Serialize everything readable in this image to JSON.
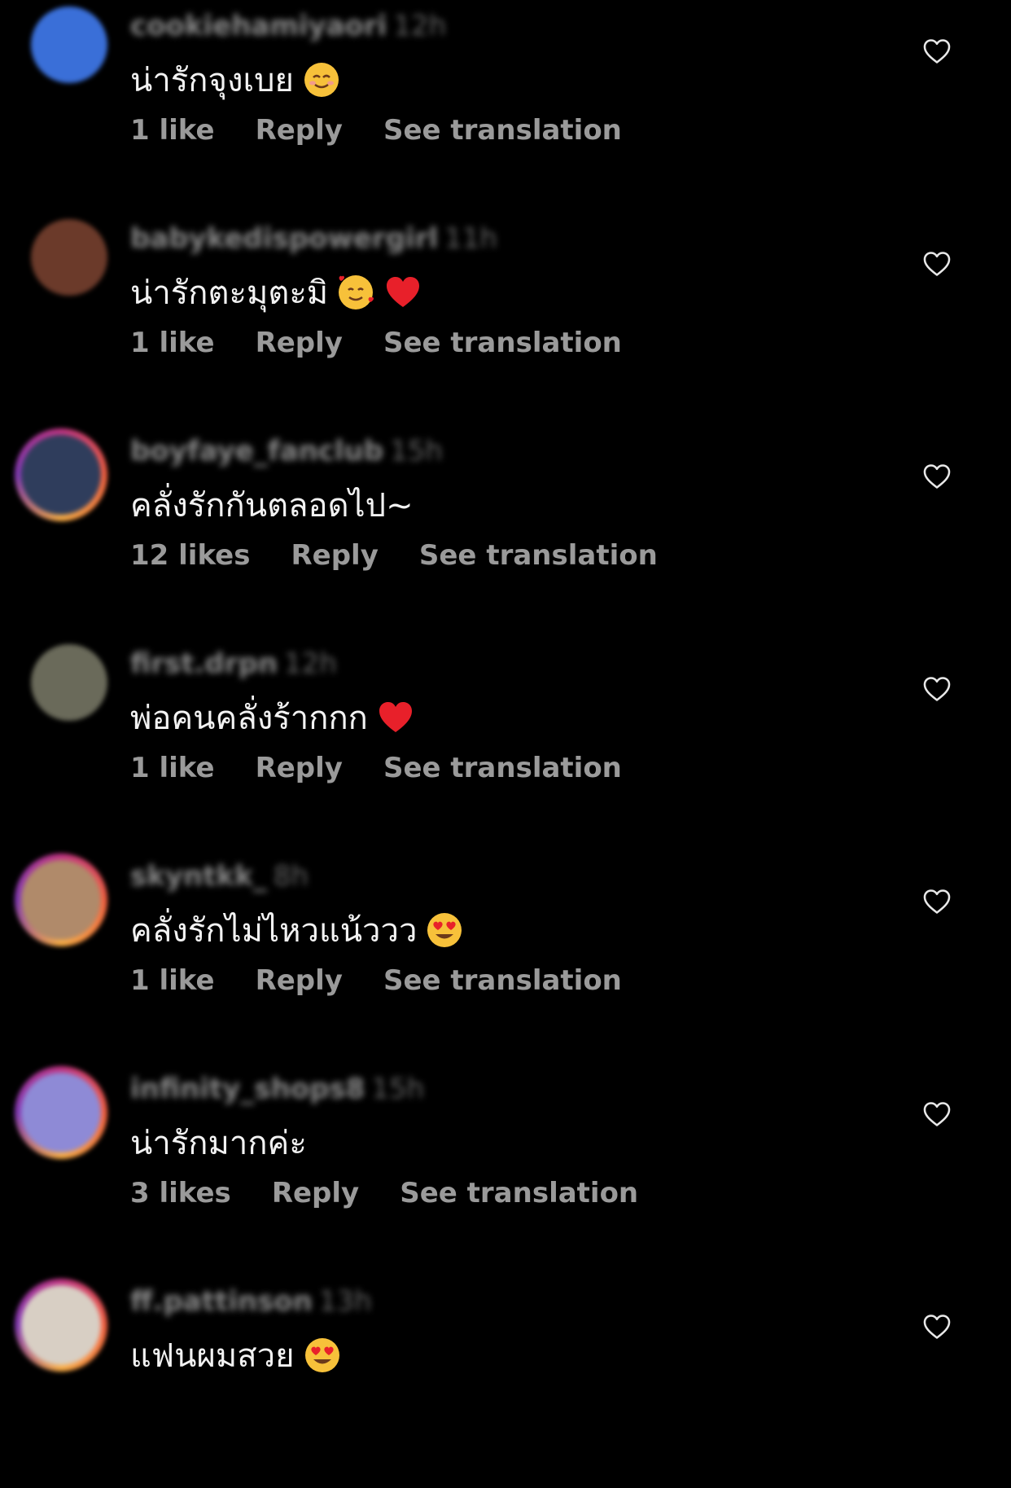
{
  "comments": [
    {
      "username": "cookiehamiyaori",
      "time": "12h",
      "text": "น่ารักจุงเบย",
      "emojis": [
        "smiling-face-icon"
      ],
      "likes": "1 like",
      "reply": "Reply",
      "translate": "See translation",
      "avatar_color": "#3a6fd8",
      "ring": false
    },
    {
      "username": "babykedispowergirl",
      "time": "11h",
      "text": "น่ารักตะมุตะมิ",
      "emojis": [
        "smiling-face-with-hearts-icon",
        "red-heart-icon"
      ],
      "likes": "1 like",
      "reply": "Reply",
      "translate": "See translation",
      "avatar_color": "#6b3a2a",
      "ring": false
    },
    {
      "username": "boyfaye_fanclub",
      "time": "15h",
      "text": "คลั่งรักกันตลอดไป~",
      "emojis": [],
      "likes": "12 likes",
      "reply": "Reply",
      "translate": "See translation",
      "avatar_color": "#2f3d5c",
      "ring": true
    },
    {
      "username": "first.drpn",
      "time": "12h",
      "text": "พ่อคนคลั่งร้ากกก",
      "emojis": [
        "red-heart-icon"
      ],
      "likes": "1 like",
      "reply": "Reply",
      "translate": "See translation",
      "avatar_color": "#6a6a5a",
      "ring": false
    },
    {
      "username": "skyntkk_",
      "time": "8h",
      "text": "คลั่งรักไม่ไหวแน้ววว",
      "emojis": [
        "heart-eyes-icon"
      ],
      "likes": "1 like",
      "reply": "Reply",
      "translate": "See translation",
      "avatar_color": "#b08a6a",
      "ring": true
    },
    {
      "username": "infinity_shops8",
      "time": "15h",
      "text": "น่ารักมากค่ะ",
      "emojis": [],
      "likes": "3 likes",
      "reply": "Reply",
      "translate": "See translation",
      "avatar_color": "#8e8ad6",
      "ring": true
    },
    {
      "username": "ff.pattinson",
      "time": "13h",
      "text": "แฟนผมสวย",
      "emojis": [
        "heart-eyes-icon"
      ],
      "likes": "",
      "reply": "",
      "translate": "",
      "avatar_color": "#d8cfc4",
      "ring": true
    }
  ],
  "colors": {
    "background": "#000000",
    "text": "#f2f2f2",
    "meta": "#9a9a9a",
    "username": "#8a8a8a"
  },
  "icons": {
    "like": "heart-outline-icon"
  }
}
